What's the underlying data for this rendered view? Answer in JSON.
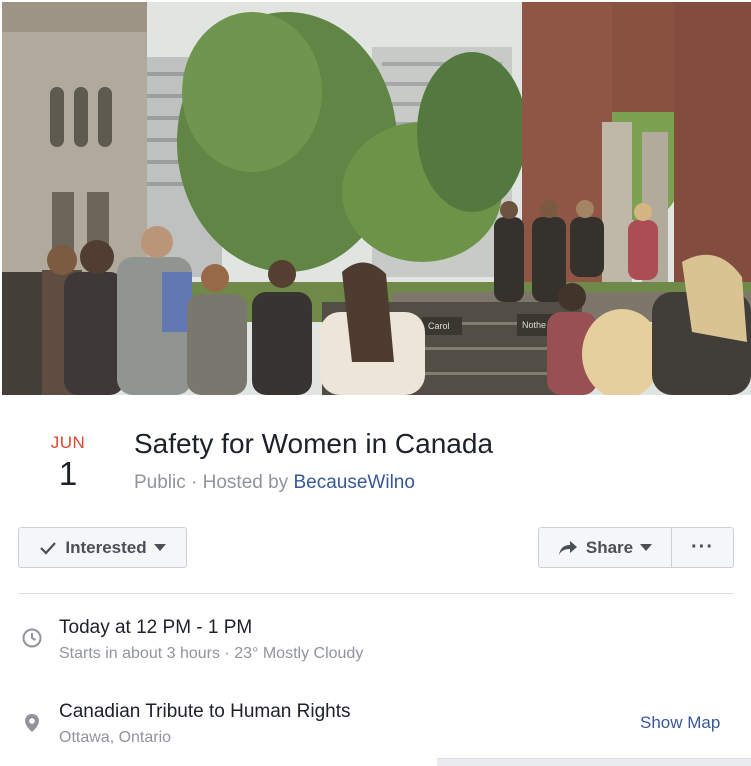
{
  "cover": {
    "sign_text_1": "Carol",
    "sign_text_2": "Nothe"
  },
  "event": {
    "month": "JUN",
    "day": "1",
    "title": "Safety for Women in Canada",
    "privacy": "Public",
    "separator": "·",
    "hosted_by_label": "Hosted by",
    "host": "BecauseWilno"
  },
  "actions": {
    "interested_label": "Interested",
    "share_label": "Share",
    "more_label": "···"
  },
  "details": {
    "time_main": "Today at 12 PM - 1 PM",
    "time_sub": "Starts in about 3 hours · 23° Mostly Cloudy",
    "location_main": "Canadian Tribute to Human Rights",
    "location_sub": "Ottawa, Ontario",
    "show_map_label": "Show Map"
  },
  "icons": {
    "time": "clock-icon",
    "location": "map-pin-icon",
    "interested": "checkmark-icon",
    "share": "share-arrow-icon"
  },
  "colors": {
    "month_red": "#e0452f",
    "link_blue": "#365899",
    "muted_gray": "#90949c"
  }
}
